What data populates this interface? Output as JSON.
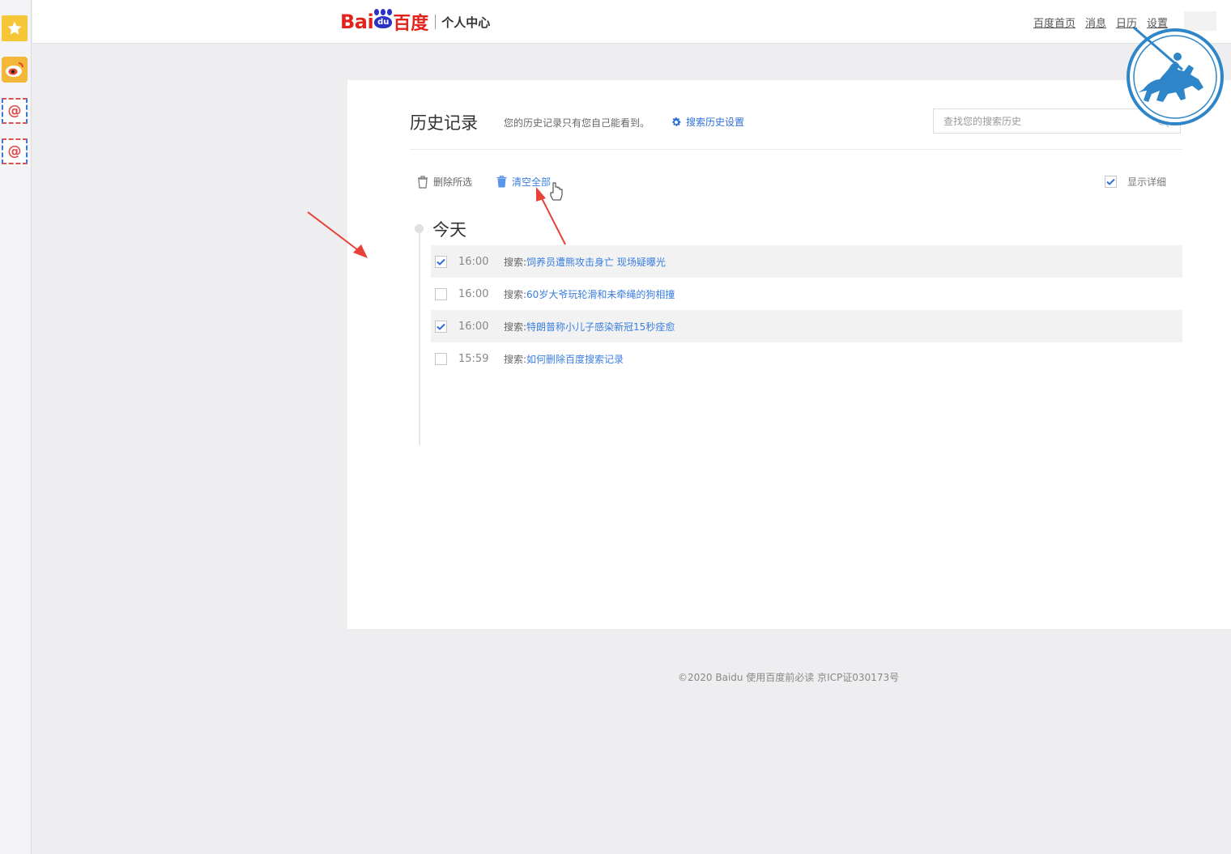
{
  "header": {
    "logo_bai": "Bai",
    "logo_du": "du",
    "logo_cn": "百度",
    "logo_sub": "个人中心",
    "nav": [
      "百度首页",
      "消息",
      "日历",
      "设置"
    ]
  },
  "page": {
    "title": "历史记录",
    "description": "您的历史记录只有您自己能看到。",
    "settings_link": "搜索历史设置",
    "search_placeholder": "查找您的搜索历史"
  },
  "toolbar": {
    "delete_selected": "删除所选",
    "clear_all": "清空全部",
    "show_details": "显示详细",
    "show_details_checked": true
  },
  "history": {
    "day": "今天",
    "records": [
      {
        "time": "16:00",
        "prefix": "搜索:",
        "query": "饲养员遭熊攻击身亡 现场疑曝光",
        "checked": true
      },
      {
        "time": "16:00",
        "prefix": "搜索:",
        "query": "60岁大爷玩轮滑和未牵绳的狗相撞",
        "checked": false
      },
      {
        "time": "16:00",
        "prefix": "搜索:",
        "query": "特朗普称小儿子感染新冠15秒痊愈",
        "checked": true
      },
      {
        "time": "15:59",
        "prefix": "搜索:",
        "query": "如何删除百度搜索记录",
        "checked": false
      }
    ]
  },
  "footer": {
    "text": "©2020 Baidu 使用百度前必读 京ICP证030173号"
  },
  "colors": {
    "brand_red": "#e1231b",
    "brand_blue": "#2a32c4",
    "link_blue": "#3a7ee0",
    "annotation_red": "#e8413a"
  },
  "icons": {
    "sidebar": [
      "star-icon",
      "weibo-icon",
      "mail-icon",
      "mail-icon"
    ],
    "settings": "gear-icon",
    "search": "search-icon",
    "delete": "trash-outline-icon",
    "clear": "trash-icon"
  }
}
